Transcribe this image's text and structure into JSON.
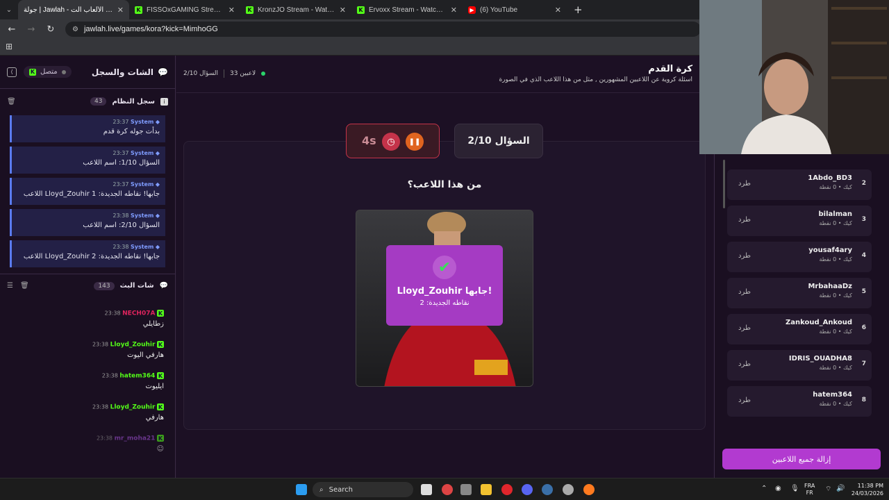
{
  "browser": {
    "tabs": [
      {
        "title": "جولة | Jawlah - منصة الألعاب الت",
        "favicon": "jw",
        "active": true
      },
      {
        "title": "FISSOxGAMING Stream - Watc",
        "favicon": "kick",
        "active": false
      },
      {
        "title": "KronzJO Stream - Watch Live o",
        "favicon": "kick",
        "active": false
      },
      {
        "title": "Ervoxx Stream - Watch Live on",
        "favicon": "kick",
        "active": false
      },
      {
        "title": "(6) YouTube",
        "favicon": "yt",
        "active": false
      }
    ],
    "new_tab": "+",
    "url": "jawlah.live/games/kora?kick=MimhoGG"
  },
  "left_panel": {
    "title": "الشات والسجل",
    "status": "متصل",
    "system_log": {
      "title": "سجل النظام",
      "count": "43",
      "entries": [
        {
          "sender": "System",
          "time": "23:37",
          "text": "بدأت جوله كرة قدم"
        },
        {
          "sender": "System",
          "time": "23:37",
          "text": "السؤال 1/10: اسم اللاعب"
        },
        {
          "sender": "System",
          "time": "23:37",
          "text": "اللاعب Lloyd_Zouhir جابها! نقاطه الجديدة: 1"
        },
        {
          "sender": "System",
          "time": "23:38",
          "text": "السؤال 2/10: اسم اللاعب"
        },
        {
          "sender": "System",
          "time": "23:38",
          "text": "اللاعب Lloyd_Zouhir جابها! نقاطه الجديدة: 2"
        }
      ]
    },
    "stream_chat": {
      "title": "شات البث",
      "count": "143",
      "messages": [
        {
          "user": "NECH07A",
          "time": "23:38",
          "text": "زطايلي",
          "color": "#e0245e"
        },
        {
          "user": "Lloyd_Zouhir",
          "time": "23:38",
          "text": "هارفي اليوت",
          "color": "#53fc18"
        },
        {
          "user": "hatem364",
          "time": "23:38",
          "text": "ايليوت",
          "color": "#53fc18"
        },
        {
          "user": "Lloyd_Zouhir",
          "time": "23:38",
          "text": "هارفي",
          "color": "#53fc18"
        },
        {
          "user": "mr_moha21",
          "time": "23:38",
          "text": "",
          "color": "#9c4fd0"
        }
      ]
    }
  },
  "main": {
    "game_title": "كرة القدم",
    "game_subtitle": "اسئلة كروية عن اللاعبين المشهورين , مثل من هذا اللاعب الذي في الصورة",
    "players_online": "33 لاعبين",
    "question_counter": "السؤال 2/10",
    "timer": "4s",
    "question_label": "السؤال 2/10",
    "prompt": "من هذا اللاعب؟",
    "result_title": "Lloyd_Zouhir جابها!",
    "result_sub": "نقاطه الجديدة: 2"
  },
  "right_panel": {
    "kick_label": "طرد",
    "players": [
      {
        "rank": "2",
        "name": "1Abdo_BD3",
        "sub": "كيك • 0 نقطة"
      },
      {
        "rank": "3",
        "name": "bilalman",
        "sub": "كيك • 0 نقطة"
      },
      {
        "rank": "4",
        "name": "yousaf4ary",
        "sub": "كيك • 0 نقطة"
      },
      {
        "rank": "5",
        "name": "MrbahaaDz",
        "sub": "كيك • 0 نقطة"
      },
      {
        "rank": "6",
        "name": "Zankoud_Ankoud",
        "sub": "كيك • 0 نقطة"
      },
      {
        "rank": "7",
        "name": "IDRIS_OUADHA8",
        "sub": "كيك • 0 نقطة"
      },
      {
        "rank": "8",
        "name": "hatem364",
        "sub": "كيك • 0 نقطة"
      }
    ],
    "remove_all": "إزالة جميع اللاعبين"
  },
  "taskbar": {
    "search": "Search",
    "lang_top": "FRA",
    "lang_bottom": "FR",
    "time": "11:38 PM",
    "date": "24/03/2026"
  },
  "colors": {
    "accent": "#b23ad0",
    "kick_green": "#53fc18",
    "timer_red": "#c4334a",
    "pause_orange": "#e0641f"
  }
}
